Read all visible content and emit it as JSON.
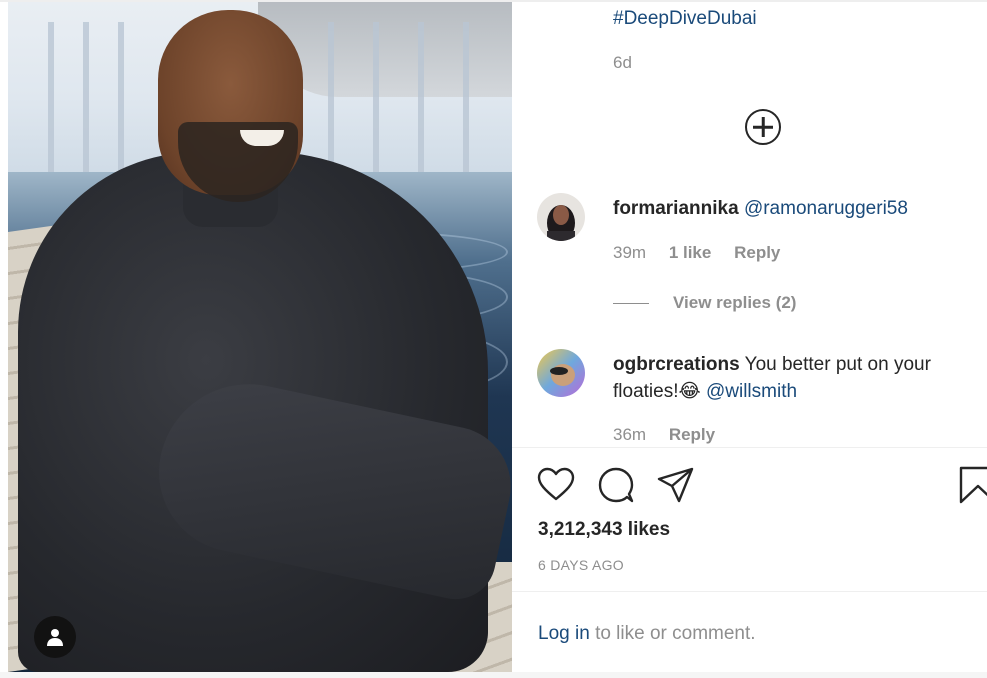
{
  "post": {
    "hashtag": "#DeepDiveDubai",
    "age": "6d"
  },
  "comments": [
    {
      "username": "formariannika",
      "text": "",
      "mention": "@ramonaruggeri58",
      "time": "39m",
      "likes": "1 like",
      "reply_label": "Reply",
      "view_replies": "View replies (2)"
    },
    {
      "username": "ogbrcreations",
      "text": "You better put on your floaties!😂",
      "mention": "@willsmith",
      "time": "36m",
      "reply_label": "Reply"
    }
  ],
  "footer": {
    "likes_count": "3,212,343 likes",
    "posted_ago": "6 DAYS AGO",
    "login_link": "Log in",
    "login_rest": "to like or comment."
  },
  "icons": {
    "load_more": "plus-circle-icon",
    "like": "heart-icon",
    "comment": "comment-bubble-icon",
    "share": "paper-plane-icon",
    "save": "bookmark-icon",
    "user": "user-icon"
  },
  "colors": {
    "link": "#1a4a7a",
    "muted": "#8e8e8e",
    "text": "#262626"
  }
}
